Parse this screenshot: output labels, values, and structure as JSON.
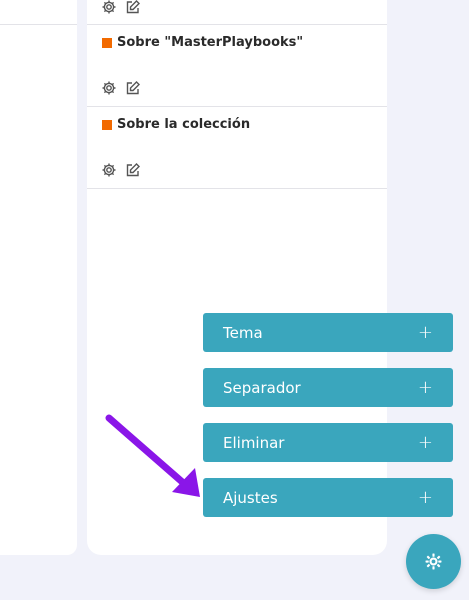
{
  "collection_items": [
    {
      "title": ""
    },
    {
      "title": "Sobre \"MasterPlaybooks\""
    },
    {
      "title": "Sobre la colección"
    }
  ],
  "item_actions": [
    {
      "icon": "gear-icon"
    },
    {
      "icon": "edit-icon"
    }
  ],
  "menu": {
    "items": [
      {
        "label": "Tema",
        "icon": "plus-icon"
      },
      {
        "label": "Separador",
        "icon": "plus-icon"
      },
      {
        "label": "Eliminar",
        "icon": "plus-icon"
      },
      {
        "label": "Ajustes",
        "icon": "plus-icon"
      }
    ],
    "plus_symbol": "+"
  },
  "fab": {
    "icon": "gear-icon"
  },
  "annotation": {
    "icon": "arrow-icon",
    "color": "#8a16e8"
  },
  "colors": {
    "accent": "#3aa6bd",
    "marker": "#f26a00",
    "background": "#f1f2fa"
  }
}
